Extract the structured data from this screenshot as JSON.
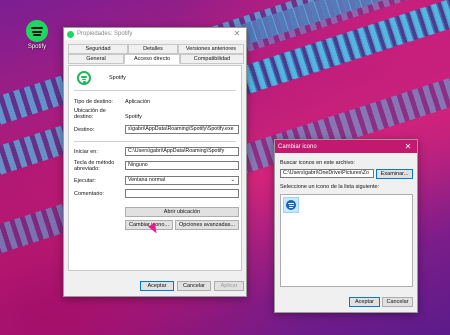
{
  "desktop": {
    "icon_label": "Spotify"
  },
  "props": {
    "title": "Propiedades: Spotify",
    "tabs_row1": [
      "Seguridad",
      "Detalles",
      "Versiones anteriores"
    ],
    "tabs_row2": [
      "General",
      "Acceso directo",
      "Compatibilidad"
    ],
    "app_name": "Spotify",
    "labels": {
      "tipo_destino": "Tipo de destino:",
      "ubicacion": "Ubicación de destino:",
      "destino": "Destino:",
      "iniciar_en": "Iniciar en:",
      "tecla": "Tecla de método abreviado:",
      "ejecutar": "Ejecutar:",
      "comentario": "Comentario:"
    },
    "values": {
      "tipo_destino": "Aplicación",
      "ubicacion": "Spotify",
      "destino": "s\\gabri\\AppData\\Roaming\\Spotify\\Spotify.exe",
      "iniciar_en": "C:\\Users\\gabri\\AppData\\Roaming\\Spotify",
      "tecla": "Ninguno",
      "ejecutar": "Ventana normal",
      "comentario": ""
    },
    "buttons": {
      "abrir_ubicacion": "Abrir ubicación",
      "cambiar_icono": "Cambiar icono...",
      "opciones_avanzadas": "Opciones avanzadas...",
      "aceptar": "Aceptar",
      "cancelar": "Cancelar",
      "aplicar": "Aplicar"
    }
  },
  "change_icon": {
    "title": "Cambiar icono",
    "search_label": "Buscar iconos en este archivo:",
    "path_value": "C:\\Users\\gabri\\OneDrive\\Pictures\\Zo",
    "browse": "Examinar...",
    "select_label": "Seleccione un icono de la lista siguiente:",
    "ok": "Aceptar",
    "cancel": "Cancelar"
  },
  "colors": {
    "accent_titlebar": "#c2186e",
    "spotify_green": "#1ed760",
    "selection": "#cce8ff"
  },
  "icons": [
    "spotify-icon",
    "close-icon",
    "chevron-down-icon",
    "mouse-cursor-icon"
  ]
}
